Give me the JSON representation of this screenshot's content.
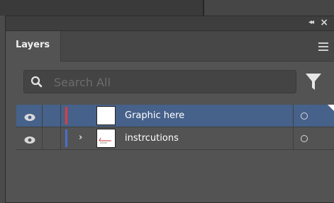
{
  "panel": {
    "tab_label": "Layers",
    "search_placeholder": "Search All"
  },
  "layers": [
    {
      "name": "Graphic here",
      "color": "#e23b3b",
      "selected": true,
      "expandable": false
    },
    {
      "name": "instrcutions",
      "color": "#4a6fcf",
      "selected": false,
      "expandable": true
    }
  ],
  "icons": {
    "collapse": "double-chevron-left-icon",
    "close": "close-icon",
    "menu": "hamburger-menu-icon",
    "search": "search-icon",
    "filter": "filter-icon",
    "visibility": "eye-icon",
    "expand": "chevron-right-icon",
    "target": "target-circle-icon"
  },
  "colors": {
    "selection": "#46618a",
    "panel_bg": "#535353"
  }
}
